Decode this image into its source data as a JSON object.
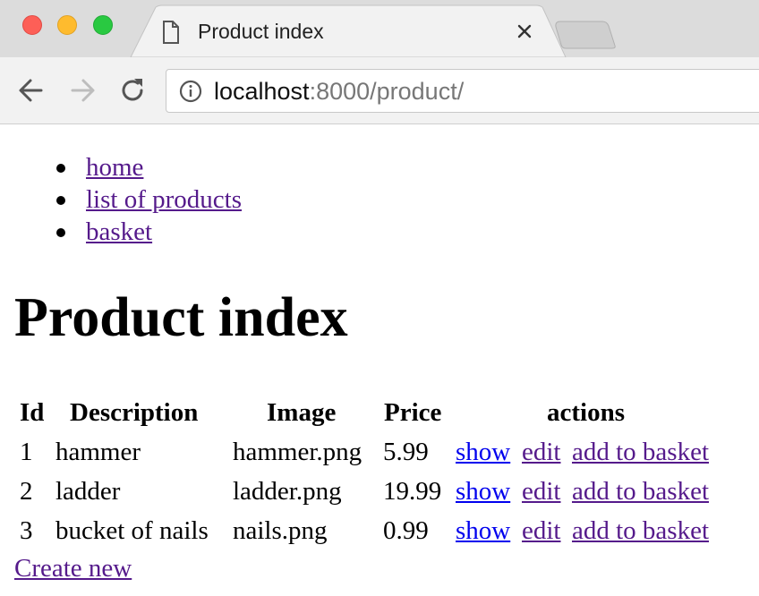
{
  "browser": {
    "tab": {
      "title": "Product index"
    },
    "address": {
      "host": "localhost",
      "rest": ":8000/product/"
    }
  },
  "nav": {
    "items": [
      {
        "label": "home"
      },
      {
        "label": "list of products"
      },
      {
        "label": "basket"
      }
    ]
  },
  "page": {
    "title": "Product index"
  },
  "table": {
    "headers": {
      "id": "Id",
      "description": "Description",
      "image": "Image",
      "price": "Price",
      "actions": "actions"
    },
    "rows": [
      {
        "id": "1",
        "description": "hammer",
        "image": "hammer.png",
        "price": "5.99",
        "show": "show",
        "edit": "edit",
        "add": "add to basket"
      },
      {
        "id": "2",
        "description": "ladder",
        "image": "ladder.png",
        "price": "19.99",
        "show": "show",
        "edit": "edit",
        "add": "add to basket"
      },
      {
        "id": "3",
        "description": "bucket of nails",
        "image": "nails.png",
        "price": "0.99",
        "show": "show",
        "edit": "edit",
        "add": "add to basket"
      }
    ]
  },
  "create_link": "Create new"
}
